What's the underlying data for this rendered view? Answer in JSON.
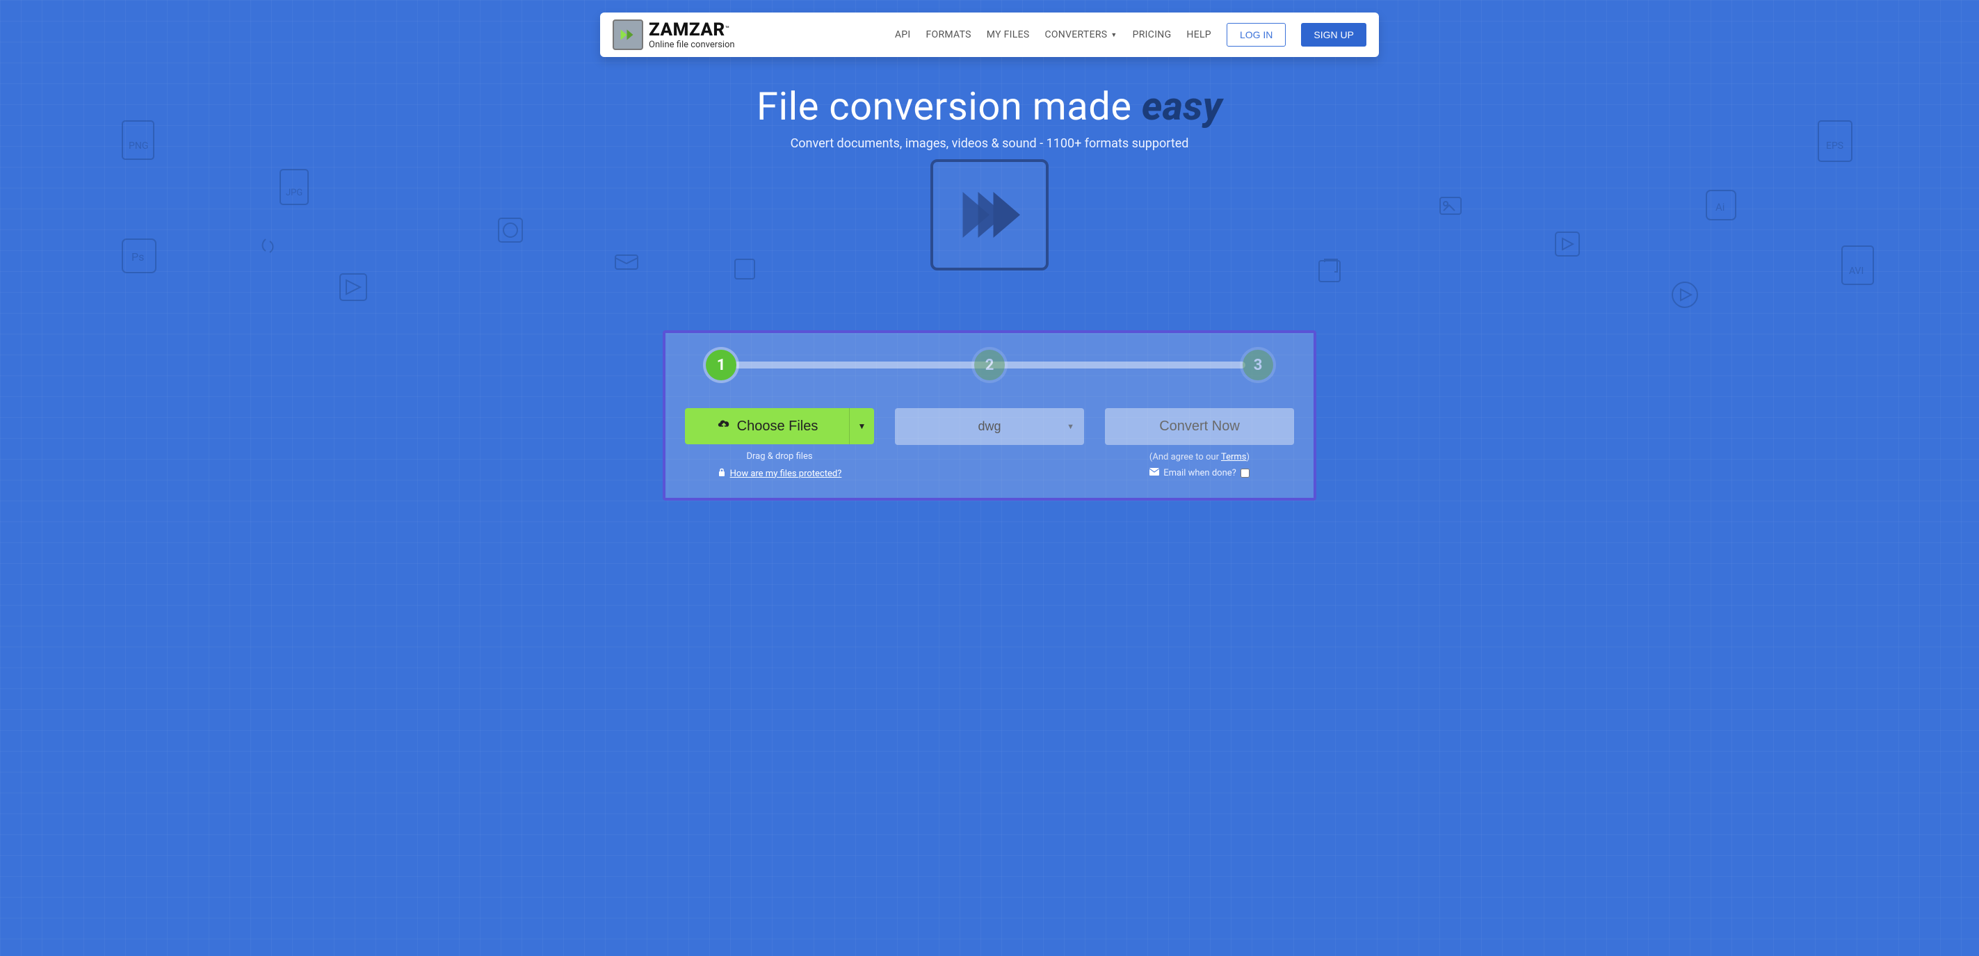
{
  "brand": {
    "name": "ZAMZAR",
    "tm": "™",
    "tagline": "Online file conversion"
  },
  "nav": {
    "api": "API",
    "formats": "FORMATS",
    "myfiles": "MY FILES",
    "converters": "CONVERTERS",
    "pricing": "PRICING",
    "help": "HELP",
    "login": "LOG IN",
    "signup": "SIGN UP"
  },
  "hero": {
    "title_prefix": "File conversion made ",
    "title_emph": "easy",
    "subtitle": "Convert documents, images, videos & sound - 1100+ formats supported"
  },
  "steps": {
    "s1": "1",
    "s2": "2",
    "s3": "3"
  },
  "panel": {
    "choose": "Choose Files",
    "drag": "Drag & drop files",
    "protect": "How are my files protected?",
    "format": "dwg",
    "convert": "Convert Now",
    "terms_prefix": "(And agree to our ",
    "terms_link": "Terms",
    "terms_suffix": ")",
    "email": "Email when done?"
  }
}
